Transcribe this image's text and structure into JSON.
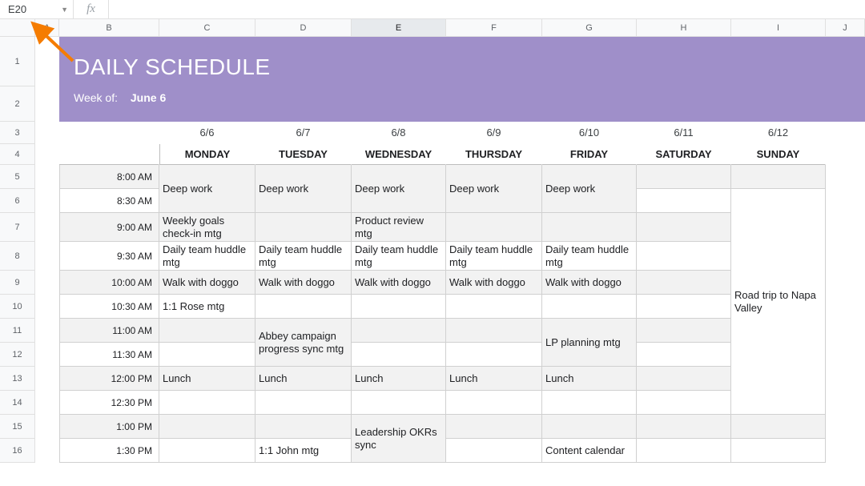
{
  "nameBox": "E20",
  "fxInput": "",
  "columns": [
    "A",
    "B",
    "C",
    "D",
    "E",
    "F",
    "G",
    "H",
    "I",
    "J"
  ],
  "rows": [
    "1",
    "2",
    "3",
    "4",
    "5",
    "6",
    "7",
    "8",
    "9",
    "10",
    "11",
    "12",
    "13",
    "14",
    "15",
    "16"
  ],
  "selectedCol": "E",
  "header": {
    "title": "DAILY SCHEDULE",
    "weekLabel": "Week of:",
    "weekDate": "June 6"
  },
  "dates": [
    "6/6",
    "6/7",
    "6/8",
    "6/9",
    "6/10",
    "6/11",
    "6/12"
  ],
  "days": [
    "MONDAY",
    "TUESDAY",
    "WEDNESDAY",
    "THURSDAY",
    "FRIDAY",
    "SATURDAY",
    "SUNDAY"
  ],
  "times": [
    "8:00 AM",
    "8:30 AM",
    "9:00 AM",
    "9:30 AM",
    "10:00 AM",
    "10:30 AM",
    "11:00 AM",
    "11:30 AM",
    "12:00 PM",
    "12:30 PM",
    "1:00 PM",
    "1:30 PM"
  ],
  "events": {
    "deepWork": "Deep work",
    "weeklyGoals": "Weekly goals check-in mtg",
    "productReview": "Product review mtg",
    "dailyHuddle": "Daily team huddle mtg",
    "walkDoggo": "Walk with doggo",
    "rose": "1:1 Rose mtg",
    "abbey": "Abbey campaign progress sync mtg",
    "lpPlanning": "LP planning mtg",
    "lunch": "Lunch",
    "leadershipOKRs": "Leadership OKRs sync",
    "john": "1:1 John mtg",
    "contentCalendar": "Content calendar",
    "roadTrip": "Road trip to Napa Valley"
  }
}
